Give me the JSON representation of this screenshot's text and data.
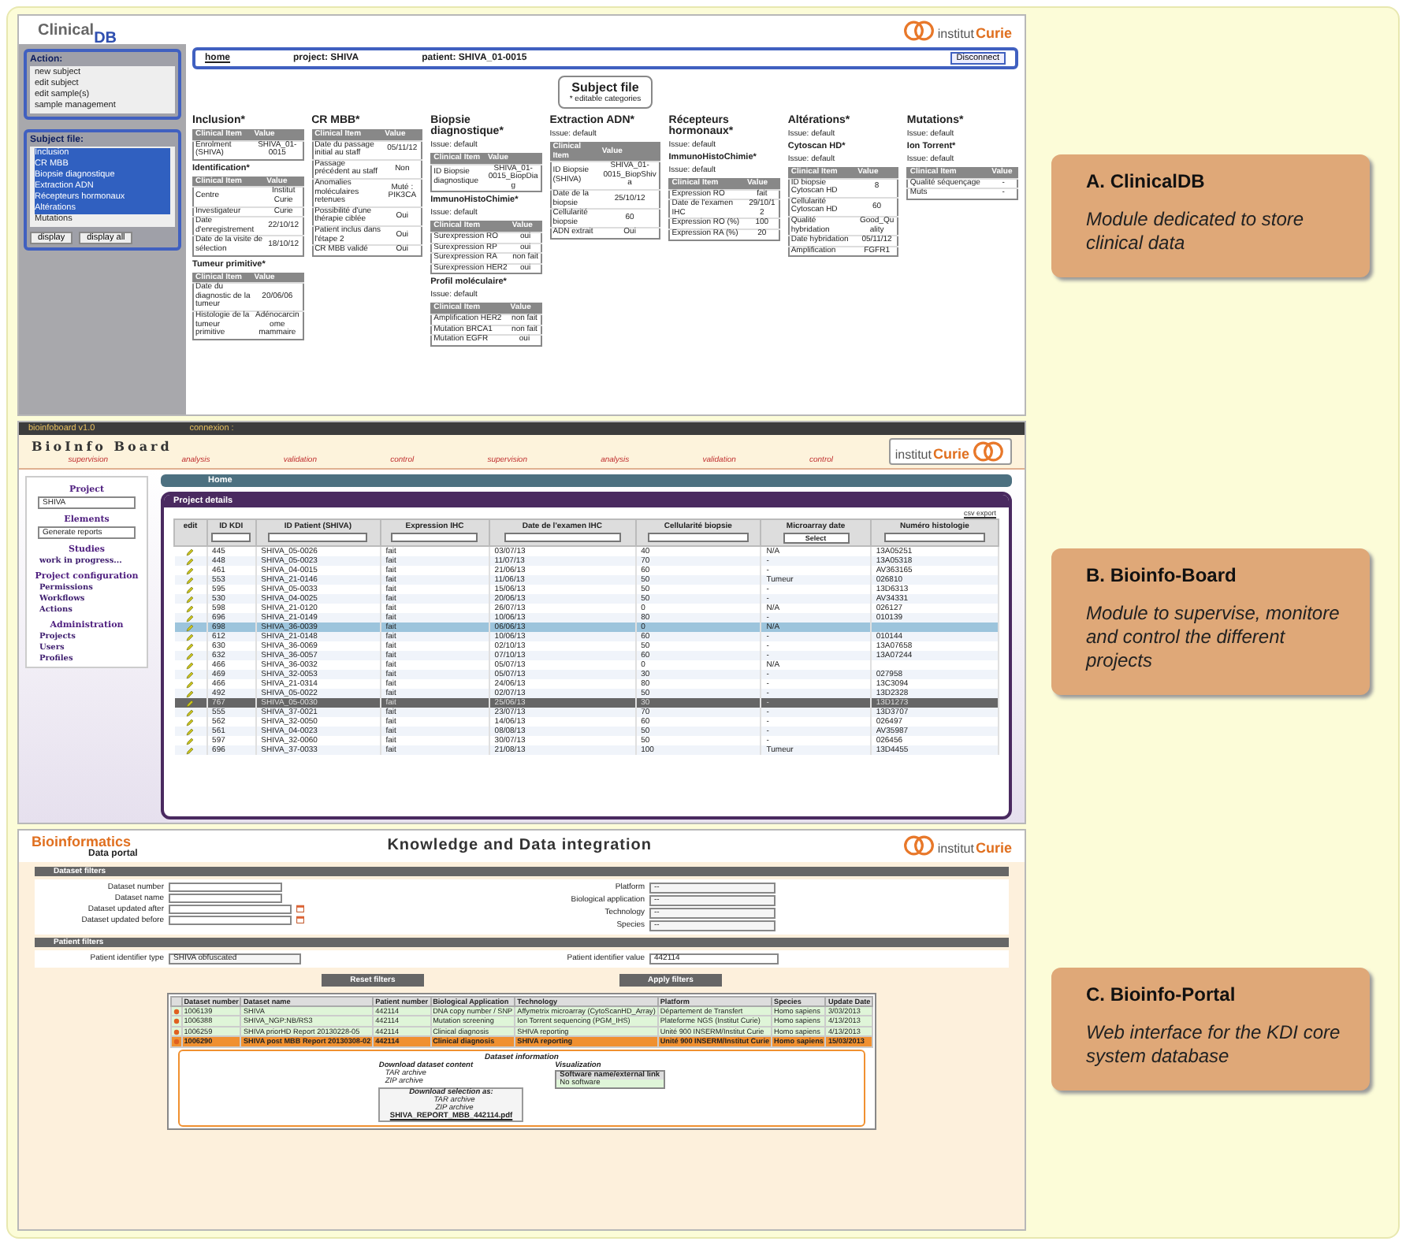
{
  "clinicaldb": {
    "logo": {
      "main": "Clinical",
      "sub": "DB"
    },
    "institute_logo": {
      "prefix": "institut",
      "name": "Curie"
    },
    "action_panel": {
      "title": "Action:",
      "items": [
        "new subject",
        "edit subject",
        "edit sample(s)",
        "sample management"
      ]
    },
    "subject_file_panel": {
      "title": "Subject file:",
      "items": [
        {
          "label": "Inclusion",
          "selected": true
        },
        {
          "label": "CR MBB",
          "selected": true
        },
        {
          "label": "Biopsie diagnostique",
          "selected": true
        },
        {
          "label": "Extraction ADN",
          "selected": true
        },
        {
          "label": "Récepteurs hormonaux",
          "selected": true
        },
        {
          "label": "Altérations",
          "selected": true
        },
        {
          "label": "Mutations",
          "selected": false
        }
      ],
      "buttons": [
        "display",
        "display all"
      ]
    },
    "breadcrumb": {
      "home": "home",
      "project": "project: SHIVA",
      "patient": "patient: SHIVA_01-0015",
      "button": "Disconnect"
    },
    "subject_file": {
      "title": "Subject file",
      "note": "* editable categories"
    },
    "categories": [
      {
        "title": "Inclusion*",
        "blocks": [
          {
            "header": [
              "Clinical Item",
              "Value"
            ],
            "rows": [
              [
                "Enrolment (SHIVA)",
                "SHIVA_01-0015"
              ]
            ]
          },
          {
            "heading": "Identification*",
            "header": [
              "Clinical Item",
              "Value"
            ],
            "rows": [
              [
                "Centre",
                "Institut Curie"
              ],
              [
                "Investigateur",
                "Curie"
              ],
              [
                "Date d'enregistrement",
                "22/10/12"
              ],
              [
                "Date de la visite de sélection",
                "18/10/12"
              ]
            ]
          },
          {
            "heading": "Tumeur primitive*",
            "header": [
              "Clinical Item",
              "Value"
            ],
            "rows": [
              [
                "Date du diagnostic de la tumeur",
                "20/06/06"
              ],
              [
                "Histologie de la tumeur primitive",
                "Adénocarcinome mammaire"
              ]
            ]
          }
        ]
      },
      {
        "title": "CR MBB*",
        "blocks": [
          {
            "header": [
              "Clinical Item",
              "Value"
            ],
            "rows": [
              [
                "Date du passage initial au staff",
                "05/11/12"
              ],
              [
                "Passage précédent au staff",
                "Non"
              ],
              [
                "Anomalies moléculaires retenues",
                "Muté : PIK3CA"
              ],
              [
                "Possibilité d'une thérapie ciblée",
                "Oui"
              ],
              [
                "Patient inclus dans l'étape 2",
                "Oui"
              ],
              [
                "CR MBB validé",
                "Oui"
              ]
            ]
          }
        ]
      },
      {
        "title": "Biopsie diagnostique*",
        "blocks": [
          {
            "issue": "Issue: default",
            "header": [
              "Clinical Item",
              "Value"
            ],
            "rows": [
              [
                "ID Biopsie diagnostique",
                "SHIVA_01-0015_BiopDiag"
              ]
            ]
          },
          {
            "heading": "ImmunoHistoChimie*",
            "issue": "Issue: default",
            "header": [
              "Clinical Item",
              "Value"
            ],
            "rows": [
              [
                "Surexpression RO",
                "oui"
              ],
              [
                "Surexpression RP",
                "oui"
              ],
              [
                "Surexpression RA",
                "non fait"
              ],
              [
                "Surexpression HER2",
                "oui"
              ]
            ]
          },
          {
            "heading": "Profil moléculaire*",
            "issue": "Issue: default",
            "header": [
              "Clinical Item",
              "Value"
            ],
            "rows": [
              [
                "Amplification HER2",
                "non fait"
              ],
              [
                "Mutation BRCA1",
                "non fait"
              ],
              [
                "Mutation EGFR",
                "oui"
              ]
            ]
          }
        ]
      },
      {
        "title": "Extraction ADN*",
        "blocks": [
          {
            "issue": "Issue: default",
            "header": [
              "Clinical Item",
              "Value"
            ],
            "rows": [
              [
                "ID Biopsie (SHIVA)",
                "SHIVA_01-0015_BiopShiva"
              ],
              [
                "Date de la biopsie",
                "25/10/12"
              ],
              [
                "Cellularité biopsie",
                "60"
              ],
              [
                "ADN extrait",
                "Oui"
              ]
            ]
          }
        ]
      },
      {
        "title": "Récepteurs hormonaux*",
        "blocks": [
          {
            "issue": "Issue: default"
          },
          {
            "heading": "ImmunoHistoChimie*",
            "issue": "Issue: default",
            "header": [
              "Clinical Item",
              "Value"
            ],
            "rows": [
              [
                "Expression RO",
                "fait"
              ],
              [
                "Date de l'examen IHC",
                "29/10/12"
              ],
              [
                "Expression RO (%)",
                "100"
              ],
              [
                "Expression RA (%)",
                "20"
              ]
            ]
          }
        ]
      },
      {
        "title": "Altérations*",
        "blocks": [
          {
            "issue": "Issue: default"
          },
          {
            "heading": "Cytoscan HD*",
            "issue": "Issue: default",
            "header": [
              "Clinical Item",
              "Value"
            ],
            "rows": [
              [
                "ID biopsie Cytoscan HD",
                "8"
              ],
              [
                "Cellularité Cytoscan HD",
                "60"
              ],
              [
                "Qualité hybridation",
                "Good_Quality"
              ],
              [
                "Date hybridation",
                "05/11/12"
              ],
              [
                "Amplification",
                "FGFR1"
              ]
            ]
          }
        ]
      },
      {
        "title": "Mutations*",
        "blocks": [
          {
            "issue": "Issue: default"
          },
          {
            "heading": "Ion Torrent*",
            "issue": "Issue: default",
            "header": [
              "Clinical Item",
              "Value"
            ],
            "rows": [
              [
                "Qualité séquençage",
                "-"
              ],
              [
                "Muts",
                "-"
              ]
            ]
          }
        ]
      }
    ]
  },
  "bioinfo_board": {
    "top_bar": {
      "version": "bioinfoboard v1.0",
      "connection": "connexion :"
    },
    "title": "BioInfo Board",
    "pipeline": [
      "supervision",
      "analysis",
      "validation",
      "control",
      "supervision",
      "analysis",
      "validation",
      "control"
    ],
    "institute_logo": {
      "prefix": "institut",
      "name": "Curie"
    },
    "sidebar": {
      "project": {
        "label": "Project",
        "value": "SHIVA"
      },
      "elements": {
        "label": "Elements",
        "value": "Generate reports"
      },
      "studies": {
        "label": "Studies",
        "item": "work in progress..."
      },
      "configuration": {
        "label": "Project configuration",
        "items": [
          "Permissions",
          "Workflows",
          "Actions"
        ]
      },
      "administration": {
        "label": "Administration",
        "items": [
          "Projects",
          "Users",
          "Profiles"
        ]
      }
    },
    "tab": "Home",
    "panel_title": "Project details",
    "export": "csv export",
    "microarray_filter": "Select",
    "columns": [
      "edit",
      "ID KDI",
      "ID Patient (SHIVA)",
      "Expression IHC",
      "Date de l'examen IHC",
      "Cellularité biopsie",
      "Microarray date",
      "Numéro histologie"
    ],
    "rows": [
      {
        "cells": [
          "",
          "445",
          "SHIVA_05-0026",
          "fait",
          "03/07/13",
          "40",
          "N/A",
          "13A05251"
        ],
        "selected": false,
        "greyed": false
      },
      {
        "cells": [
          "",
          "448",
          "SHIVA_05-0023",
          "fait",
          "11/07/13",
          "70",
          "-",
          "13A05318"
        ],
        "selected": false,
        "greyed": false
      },
      {
        "cells": [
          "",
          "461",
          "SHIVA_04-0015",
          "fait",
          "21/06/13",
          "60",
          "-",
          "AV363165"
        ],
        "selected": false,
        "greyed": false
      },
      {
        "cells": [
          "",
          "553",
          "SHIVA_21-0146",
          "fait",
          "11/06/13",
          "50",
          "Tumeur",
          "026810"
        ],
        "selected": false,
        "greyed": false
      },
      {
        "cells": [
          "",
          "595",
          "SHIVA_05-0033",
          "fait",
          "15/06/13",
          "50",
          "-",
          "13D6313"
        ],
        "selected": false,
        "greyed": false
      },
      {
        "cells": [
          "",
          "530",
          "SHIVA_04-0025",
          "fait",
          "20/06/13",
          "50",
          "-",
          "AV34331"
        ],
        "selected": false,
        "greyed": false
      },
      {
        "cells": [
          "",
          "598",
          "SHIVA_21-0120",
          "fait",
          "26/07/13",
          "0",
          "N/A",
          "026127"
        ],
        "selected": false,
        "greyed": false
      },
      {
        "cells": [
          "",
          "696",
          "SHIVA_21-0149",
          "fait",
          "10/06/13",
          "80",
          "-",
          "010139"
        ],
        "selected": false,
        "greyed": false
      },
      {
        "cells": [
          "",
          "698",
          "SHIVA_36-0039",
          "fait",
          "06/06/13",
          "0",
          "N/A",
          ""
        ],
        "selected": true,
        "greyed": false
      },
      {
        "cells": [
          "",
          "612",
          "SHIVA_21-0148",
          "fait",
          "10/06/13",
          "60",
          "-",
          "010144"
        ],
        "selected": false,
        "greyed": false
      },
      {
        "cells": [
          "",
          "630",
          "SHIVA_36-0069",
          "fait",
          "02/10/13",
          "50",
          "-",
          "13A07658"
        ],
        "selected": false,
        "greyed": false
      },
      {
        "cells": [
          "",
          "632",
          "SHIVA_36-0057",
          "fait",
          "07/10/13",
          "60",
          "-",
          "13A07244"
        ],
        "selected": false,
        "greyed": false
      },
      {
        "cells": [
          "",
          "466",
          "SHIVA_36-0032",
          "fait",
          "05/07/13",
          "0",
          "N/A",
          ""
        ],
        "selected": false,
        "greyed": false
      },
      {
        "cells": [
          "",
          "469",
          "SHIVA_32-0053",
          "fait",
          "05/07/13",
          "30",
          "-",
          "027958"
        ],
        "selected": false,
        "greyed": false
      },
      {
        "cells": [
          "",
          "466",
          "SHIVA_21-0314",
          "fait",
          "24/06/13",
          "80",
          "-",
          "13C3094"
        ],
        "selected": false,
        "greyed": false
      },
      {
        "cells": [
          "",
          "492",
          "SHIVA_05-0022",
          "fait",
          "02/07/13",
          "50",
          "-",
          "13D2328"
        ],
        "selected": false,
        "greyed": false
      },
      {
        "cells": [
          "",
          "767",
          "SHIVA_05-0030",
          "fait",
          "25/06/13",
          "30",
          "-",
          "13D1273"
        ],
        "selected": false,
        "greyed": true
      },
      {
        "cells": [
          "",
          "555",
          "SHIVA_37-0021",
          "fait",
          "23/07/13",
          "70",
          "-",
          "13D3707"
        ],
        "selected": false,
        "greyed": false
      },
      {
        "cells": [
          "",
          "562",
          "SHIVA_32-0050",
          "fait",
          "14/06/13",
          "60",
          "-",
          "026497"
        ],
        "selected": false,
        "greyed": false
      },
      {
        "cells": [
          "",
          "561",
          "SHIVA_04-0023",
          "fait",
          "08/08/13",
          "50",
          "-",
          "AV35987"
        ],
        "selected": false,
        "greyed": false
      },
      {
        "cells": [
          "",
          "597",
          "SHIVA_32-0060",
          "fait",
          "30/07/13",
          "50",
          "-",
          "026456"
        ],
        "selected": false,
        "greyed": false
      },
      {
        "cells": [
          "",
          "696",
          "SHIVA_37-0033",
          "fait",
          "21/08/13",
          "100",
          "Tumeur",
          "13D4455"
        ],
        "selected": false,
        "greyed": false
      }
    ]
  },
  "bioinfo_portal": {
    "logo": {
      "main": "Bioinformatics",
      "sub": "Data portal"
    },
    "title": "Knowledge and Data integration",
    "institute_logo": {
      "prefix": "institut",
      "name": "Curie"
    },
    "dataset_filters": {
      "title": "Dataset filters",
      "fields": [
        {
          "label": "Dataset number",
          "kind": "text"
        },
        {
          "label": "Dataset name",
          "kind": "text"
        },
        {
          "label": "Dataset updated after",
          "kind": "date"
        },
        {
          "label": "Dataset updated before",
          "kind": "date"
        }
      ],
      "selects": [
        {
          "label": "Platform",
          "value": "--"
        },
        {
          "label": "Biological application",
          "value": "--"
        },
        {
          "label": "Technology",
          "value": "--"
        },
        {
          "label": "Species",
          "value": "--"
        }
      ]
    },
    "patient_filters": {
      "title": "Patient filters",
      "type_label": "Patient identifier type",
      "type_value": "SHIVA obfuscated",
      "value_label": "Patient identifier value",
      "value": "442114"
    },
    "buttons": [
      "Reset filters",
      "Apply filters"
    ],
    "columns": [
      "Dataset number",
      "Dataset name",
      "Patient number",
      "Biological Application",
      "Technology",
      "Platform",
      "Species",
      "Update Date"
    ],
    "rows": [
      {
        "cells": [
          "1006139",
          "SHIVA",
          "442114",
          "DNA copy number / SNP",
          "Affymetrix microarray (CytoScanHD_Array)",
          "Département de Transfert",
          "Homo sapiens",
          "3/03/2013"
        ],
        "selected": false
      },
      {
        "cells": [
          "1006388",
          "SHIVA_NGP:NB/RS3",
          "442114",
          "Mutation screening",
          "Ion Torrent sequencing (PGM_IHS)",
          "Plateforme NGS (Institut Curie)",
          "Homo sapiens",
          "4/13/2013"
        ],
        "selected": false
      },
      {
        "cells": [
          "1006259",
          "SHIVA priorHD Report 20130228-05",
          "442114",
          "Clinical diagnosis",
          "SHIVA reporting",
          "Unité 900 INSERM/Institut Curie",
          "Homo sapiens",
          "4/13/2013"
        ],
        "selected": false
      },
      {
        "cells": [
          "1006290",
          "SHIVA post MBB Report 20130308-02",
          "442114",
          "Clinical diagnosis",
          "SHIVA reporting",
          "Unité 900 INSERM/Institut Curie",
          "Homo sapiens",
          "15/03/2013"
        ],
        "selected": true
      }
    ],
    "dataset_info": {
      "title": "Dataset information",
      "download_title": "Download dataset content",
      "archives": [
        "TAR archive",
        "ZIP archive"
      ],
      "visualization_title": "Visualization",
      "software_header": "Software name/external link",
      "software": "No software",
      "selection_title": "Download selection as:",
      "selection_archives": [
        "TAR archive",
        "ZIP archive"
      ],
      "file": "SHIVA_REPORT_MBB_442114.pdf"
    }
  },
  "labels": [
    {
      "title": "A. ClinicalDB",
      "description": "Module dedicated to store clinical data"
    },
    {
      "title": "B. Bioinfo-Board",
      "description": "Module to supervise, monitore and control the different projects"
    },
    {
      "title": "C. Bioinfo-Portal",
      "description": "Web interface for the KDI core system database"
    }
  ]
}
